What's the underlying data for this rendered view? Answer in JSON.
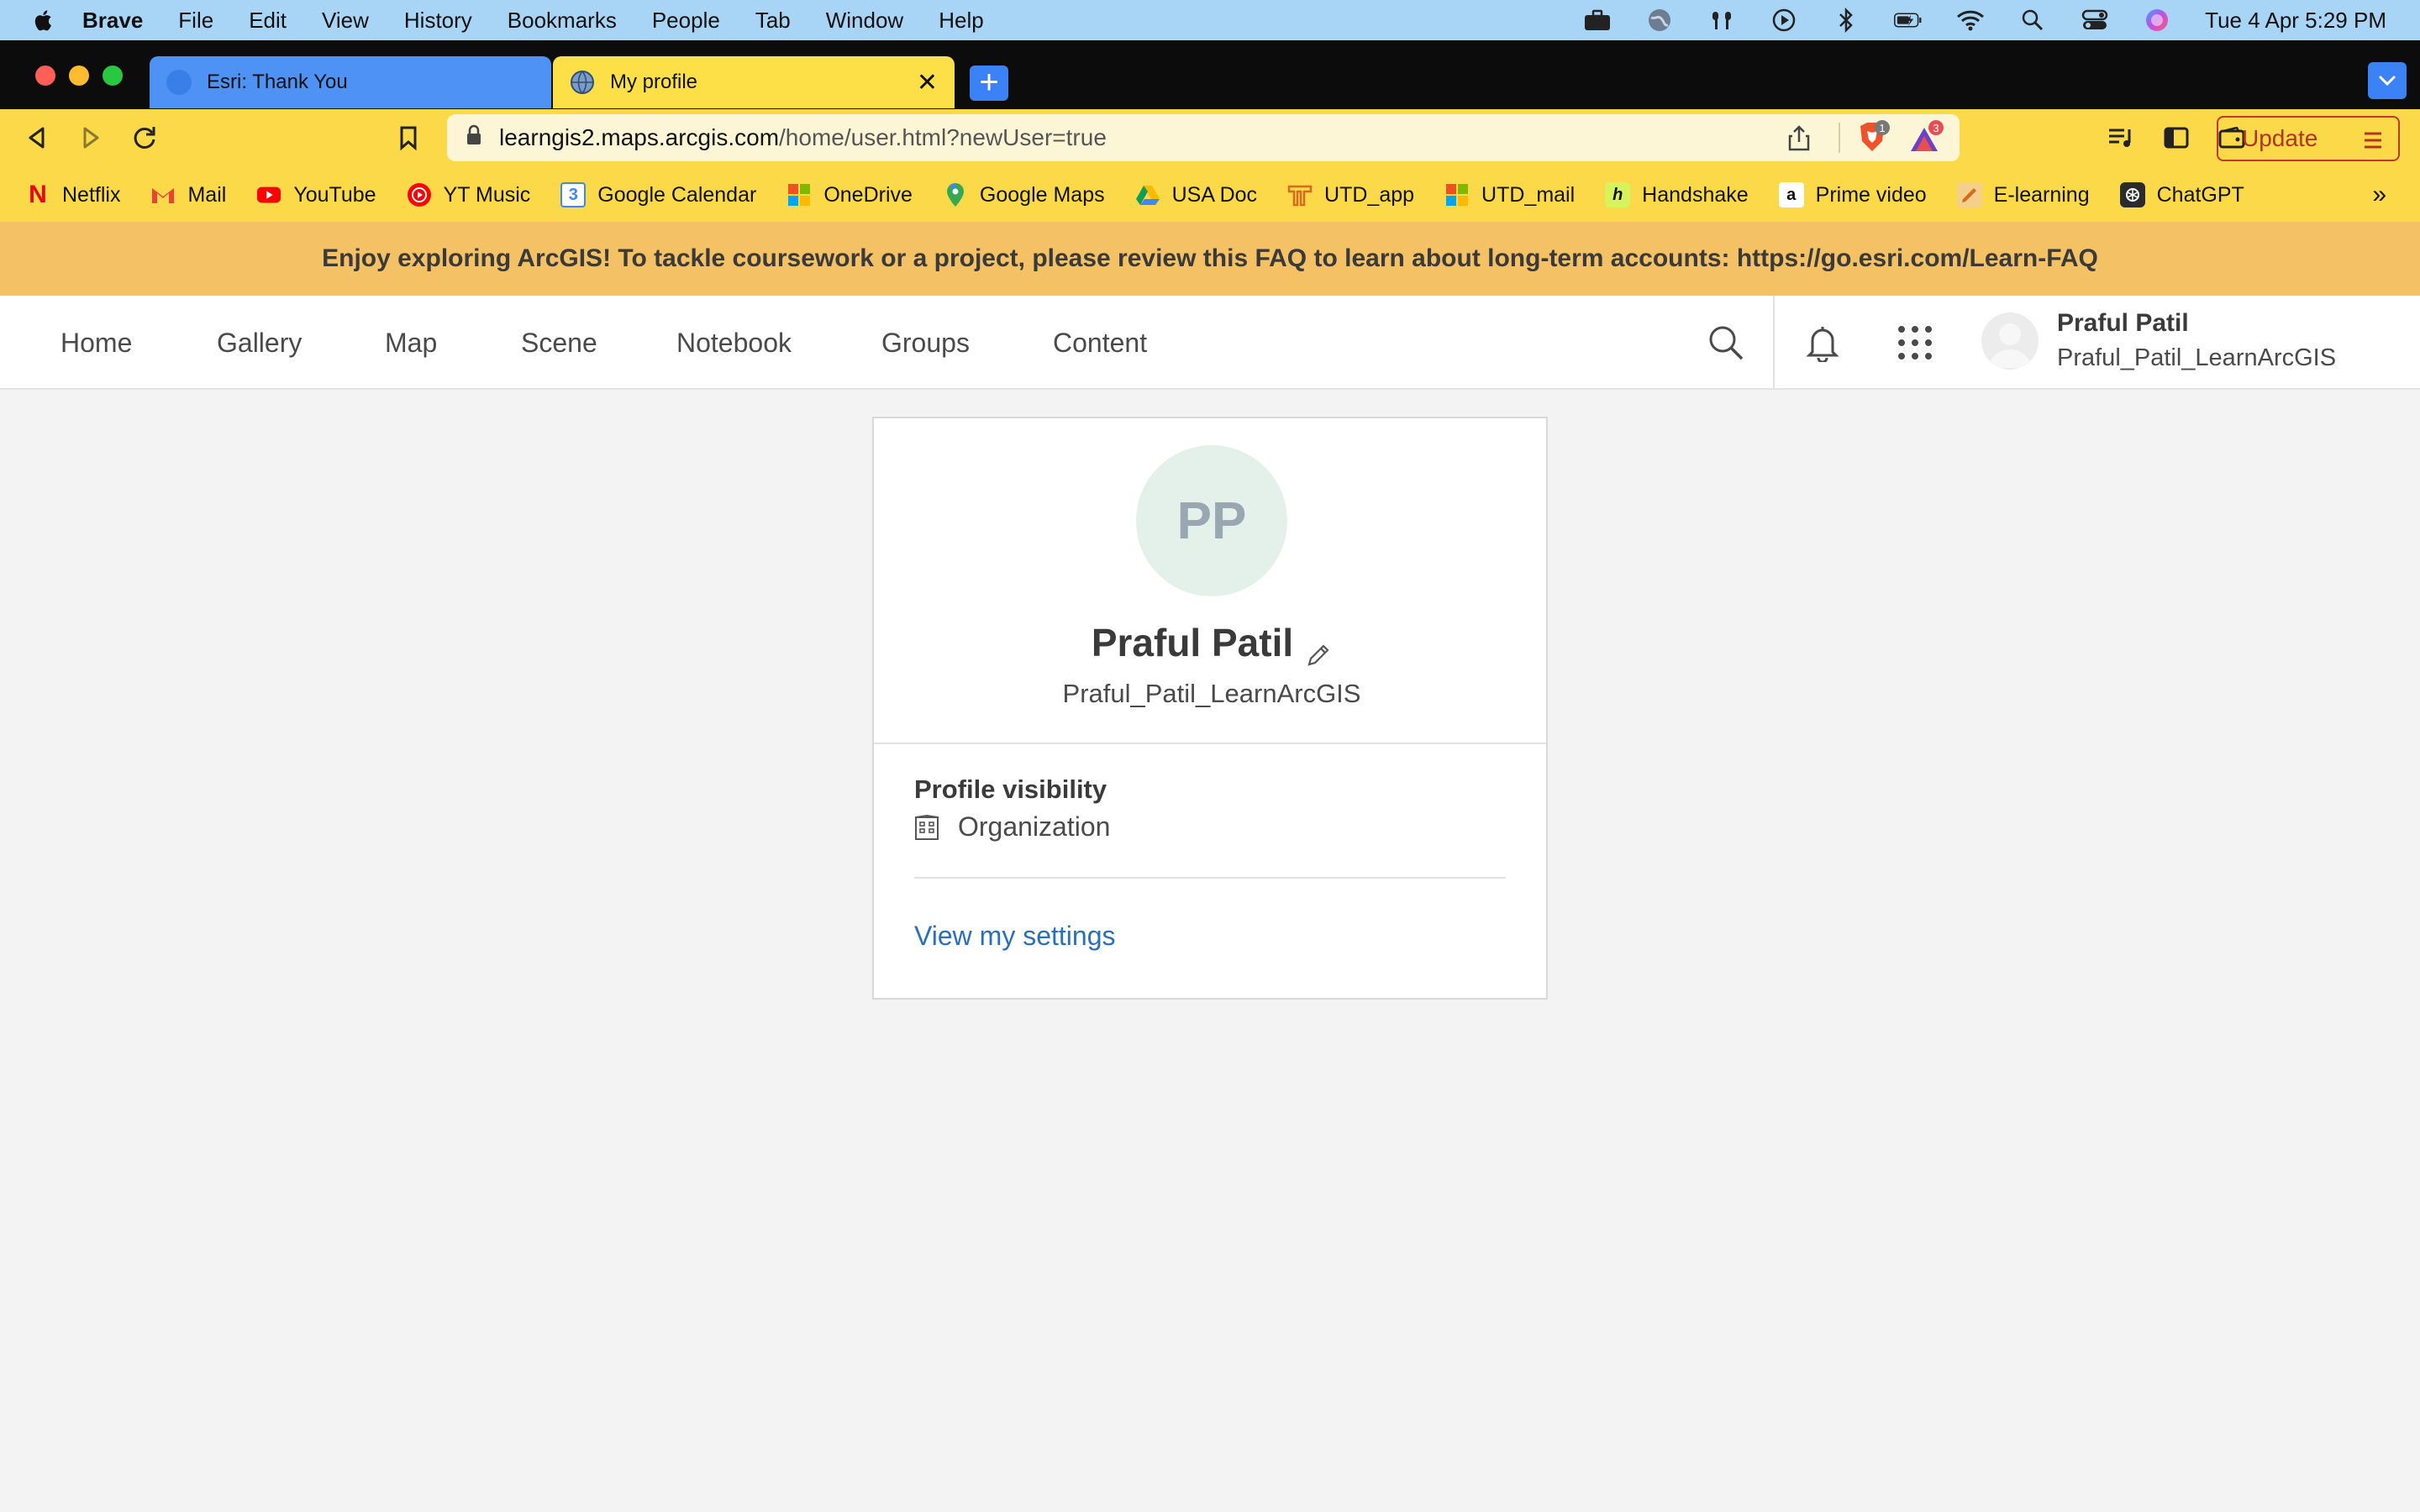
{
  "menubar": {
    "app_name": "Brave",
    "items": [
      "File",
      "Edit",
      "View",
      "History",
      "Bookmarks",
      "People",
      "Tab",
      "Window",
      "Help"
    ],
    "clock": "Tue 4 Apr  5:29 PM"
  },
  "tabs": [
    {
      "title": "Esri: Thank You",
      "active": false
    },
    {
      "title": "My profile",
      "active": true,
      "close": "✕"
    }
  ],
  "new_tab_label": "+",
  "toolbar": {
    "url_domain": "learngis2.maps.arcgis.com",
    "url_path": "/home/user.html?newUser=true",
    "update_label": "Update",
    "shields_count": "1",
    "rewards_count": "3"
  },
  "bookmarks": {
    "items": [
      "Netflix",
      "Mail",
      "YouTube",
      "YT Music",
      "Google Calendar",
      "OneDrive",
      "Google Maps",
      "USA Doc",
      "UTD_app",
      "UTD_mail",
      "Handshake",
      "Prime video",
      "E-learning",
      "ChatGPT"
    ],
    "more": "»"
  },
  "banner": {
    "text": "Enjoy exploring ArcGIS! To tackle coursework or a project, please review this FAQ to learn about long-term accounts: https://go.esri.com/Learn-FAQ"
  },
  "nav": {
    "links": [
      "Home",
      "Gallery",
      "Map",
      "Scene",
      "Notebook",
      "Groups",
      "Content"
    ],
    "user_name": "Praful Patil",
    "user_handle": "Praful_Patil_LearnArcGIS"
  },
  "profile": {
    "initials": "PP",
    "name": "Praful Patil",
    "username": "Praful_Patil_LearnArcGIS",
    "visibility_title": "Profile visibility",
    "visibility_value": "Organization",
    "settings_link": "View my settings"
  },
  "colors": {
    "menubar": "#a8d4f5",
    "browser_chrome": "#fbd949",
    "banner": "#f4c265",
    "link": "#2a6fb8",
    "avatar_bg": "#e3f1ea"
  }
}
